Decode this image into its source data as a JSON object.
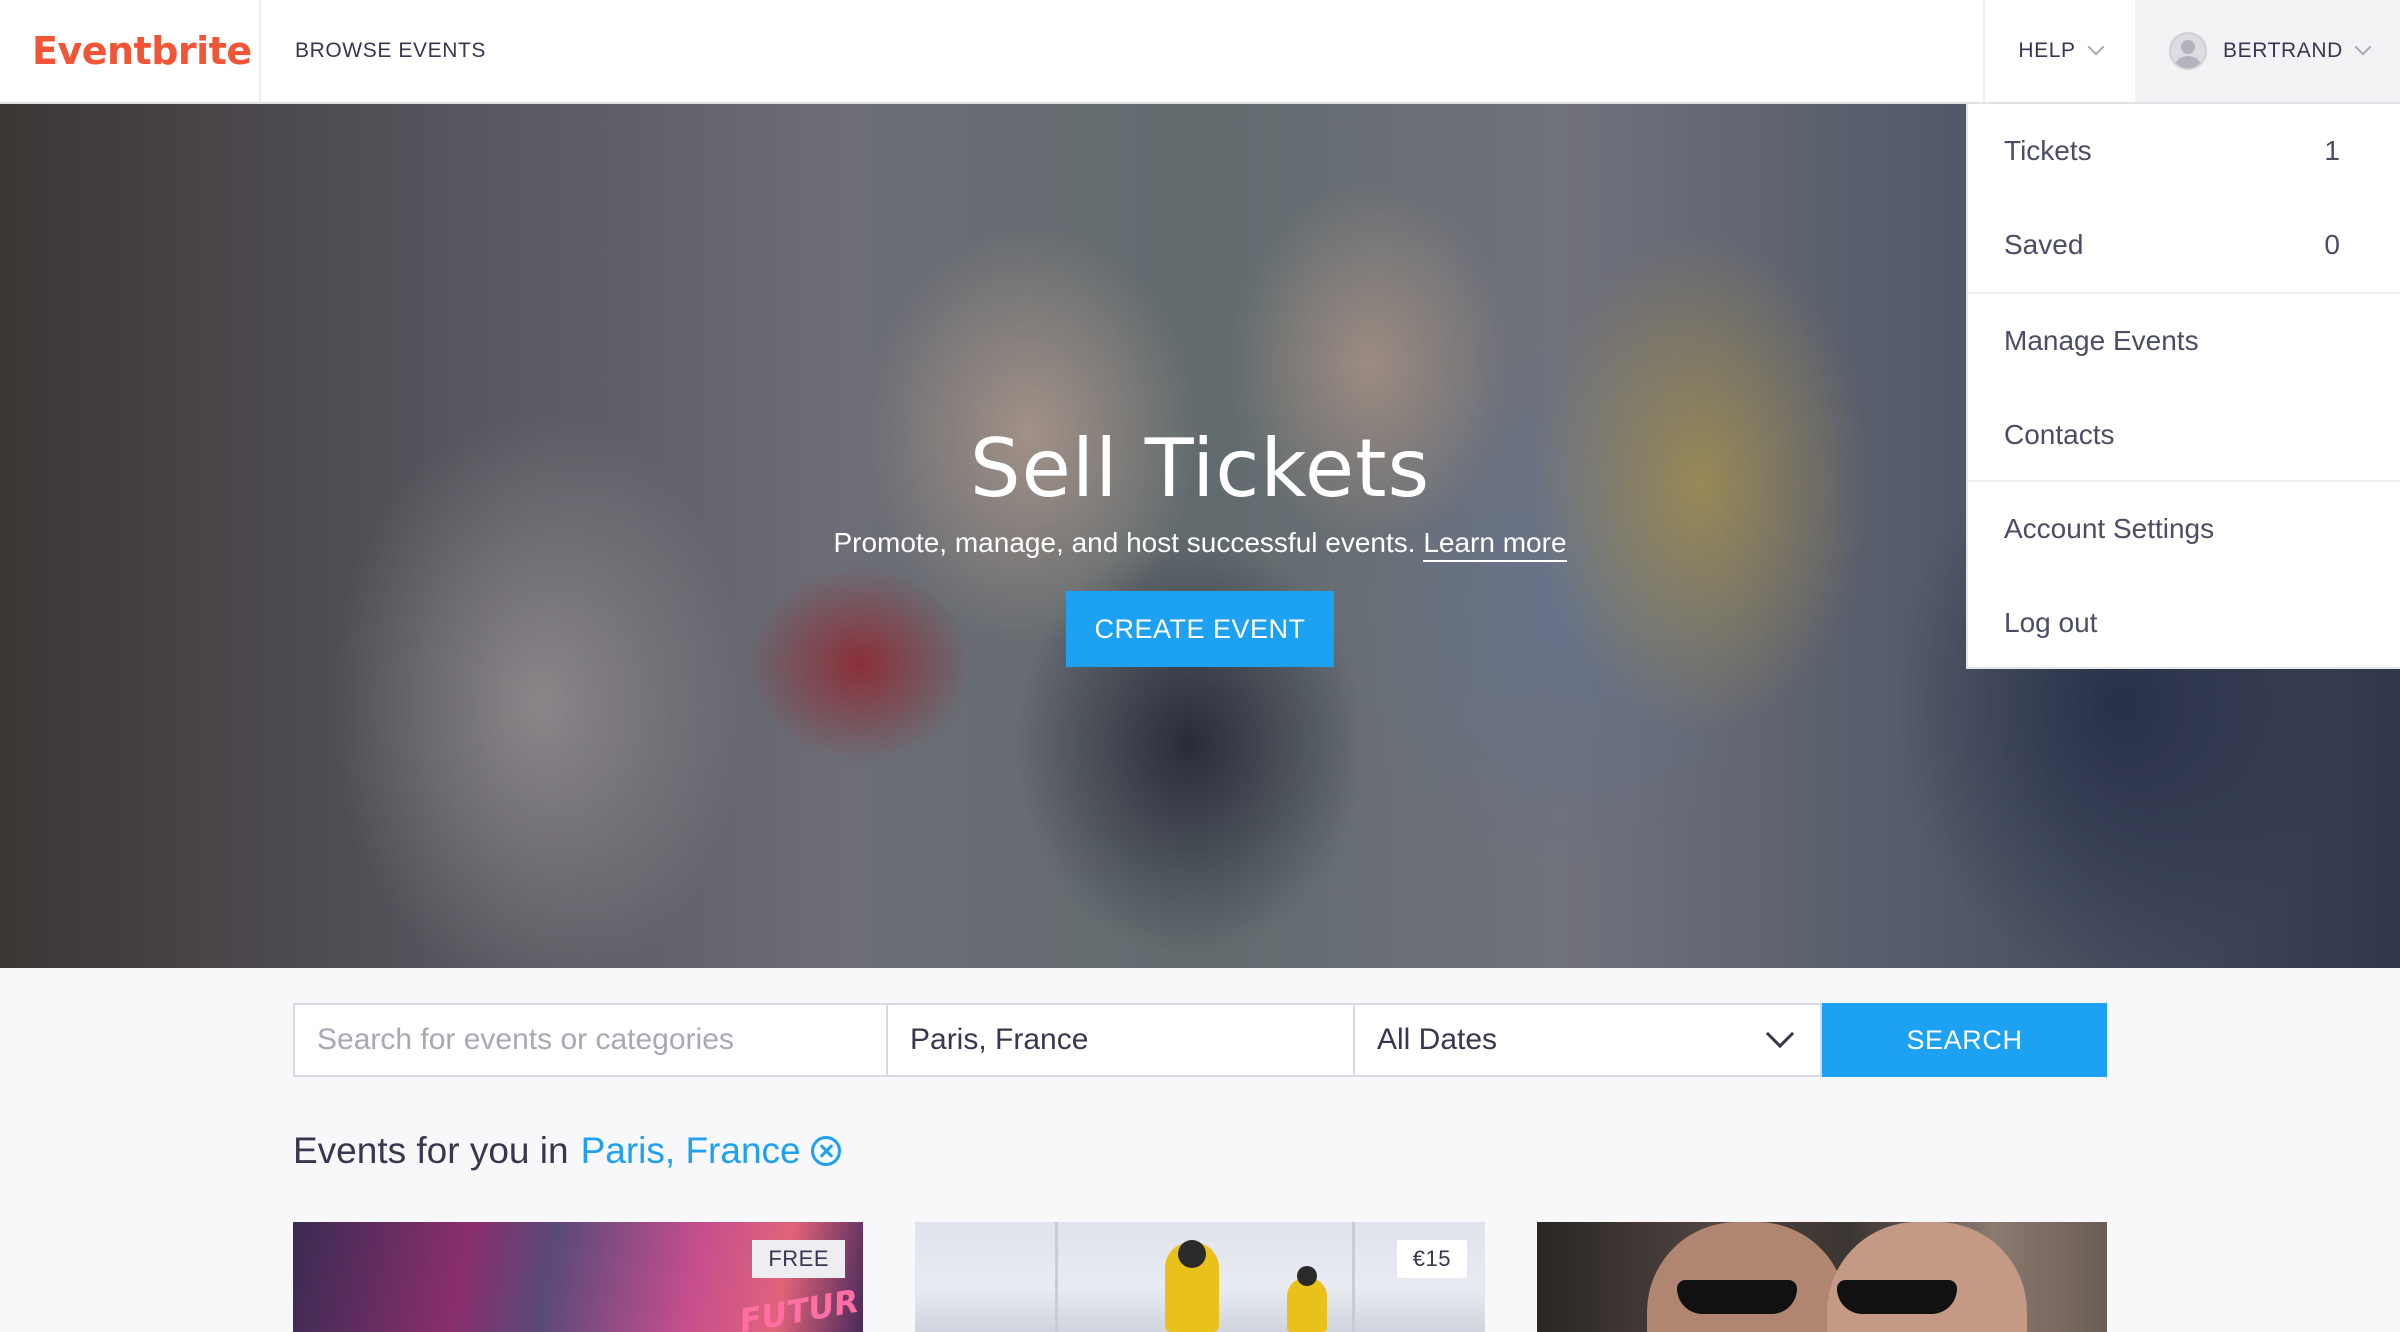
{
  "header": {
    "logo": "Eventbrite",
    "browse_label": "BROWSE EVENTS",
    "help_label": "HELP",
    "user_label": "BERTRAND"
  },
  "hero": {
    "title": "Sell Tickets",
    "subtitle": "Promote, manage, and host successful events.",
    "learn_more": "Learn more",
    "cta_label": "CREATE EVENT"
  },
  "user_menu": {
    "items": [
      {
        "label": "Tickets",
        "count": "1"
      },
      {
        "label": "Saved",
        "count": "0"
      },
      {
        "label": "Manage Events"
      },
      {
        "label": "Contacts"
      },
      {
        "label": "Account Settings"
      },
      {
        "label": "Log out"
      }
    ]
  },
  "search": {
    "query_placeholder": "Search for events or categories",
    "location_value": "Paris, France",
    "date_value": "All Dates",
    "button_label": "SEARCH"
  },
  "events": {
    "heading_prefix": "Events for you in",
    "location": "Paris, France",
    "cards": [
      {
        "price": "FREE",
        "image_text": "FUTUR"
      },
      {
        "price": "€15"
      },
      {
        "price": ""
      }
    ]
  },
  "colors": {
    "brand": "#f05537",
    "accent": "#1da1f2"
  }
}
